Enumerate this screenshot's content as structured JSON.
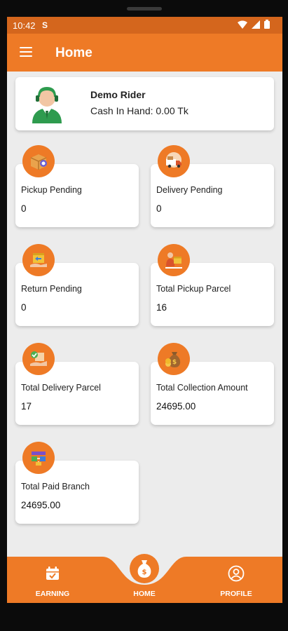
{
  "status_bar": {
    "time": "10:42",
    "status_glyph": "S"
  },
  "app_bar": {
    "title": "Home"
  },
  "rider": {
    "name": "Demo Rider",
    "cash_in_hand": "Cash In Hand: 0.00 Tk"
  },
  "stats": [
    {
      "label": "Pickup Pending",
      "value": "0",
      "icon": "box-icon"
    },
    {
      "label": "Delivery Pending",
      "value": "0",
      "icon": "truck-icon"
    },
    {
      "label": "Return Pending",
      "value": "0",
      "icon": "return-box-icon"
    },
    {
      "label": "Total Pickup Parcel",
      "value": "16",
      "icon": "parcel-hand-icon"
    },
    {
      "label": "Total Delivery Parcel",
      "value": "17",
      "icon": "delivery-hand-icon"
    },
    {
      "label": "Total Collection Amount",
      "value": "24695.00",
      "icon": "money-bag-icon"
    },
    {
      "label": "Total Paid Branch",
      "value": "24695.00",
      "icon": "branch-icon"
    }
  ],
  "bottom_nav": {
    "earning": "EARNING",
    "home": "HOME",
    "profile": "PROFILE"
  },
  "colors": {
    "primary": "#ee7a26",
    "status_bar": "#d4661d",
    "background": "#ececec",
    "card": "#ffffff"
  }
}
